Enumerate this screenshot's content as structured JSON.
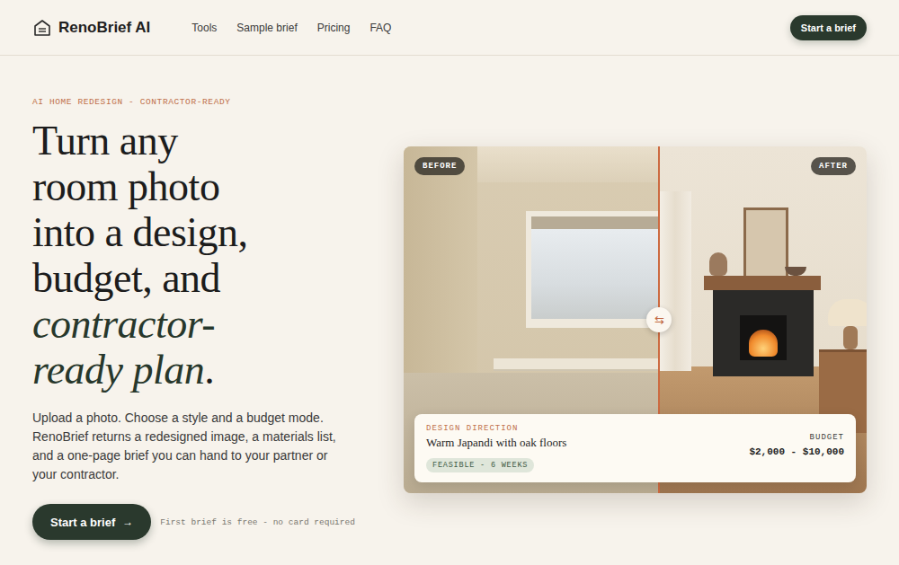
{
  "brand": {
    "name": "RenoBrief AI"
  },
  "nav": [
    {
      "label": "Tools"
    },
    {
      "label": "Sample brief"
    },
    {
      "label": "Pricing"
    },
    {
      "label": "FAQ"
    }
  ],
  "header_cta": {
    "label": "Start a brief"
  },
  "hero": {
    "eyebrow": "AI HOME REDESIGN - CONTRACTOR-READY",
    "heading": [
      {
        "text": "Turn any",
        "italic": false
      },
      {
        "text": "room photo",
        "italic": false
      },
      {
        "text": "into a design,",
        "italic": false
      },
      {
        "text": "budget, and",
        "italic": false
      },
      {
        "text": "contractor-",
        "italic": true
      },
      {
        "text": "ready plan",
        "italic": true,
        "suffix": "."
      }
    ],
    "body": "Upload a photo. Choose a style and a budget mode. RenoBrief returns a redesigned image, a materials list, and a one-page brief you can hand to your partner or your contractor.",
    "cta": {
      "label": "Start a brief",
      "icon": "→"
    },
    "note": "First brief is free - no card required"
  },
  "preview": {
    "before_label": "BEFORE",
    "after_label": "AFTER",
    "handle_icon": "⇆",
    "direction_label": "DESIGN DIRECTION",
    "direction": "Warm Japandi with oak floors",
    "tag": "FEASIBLE - 6 WEEKS",
    "budget_label": "BUDGET",
    "budget": "$2,000 - $10,000"
  }
}
